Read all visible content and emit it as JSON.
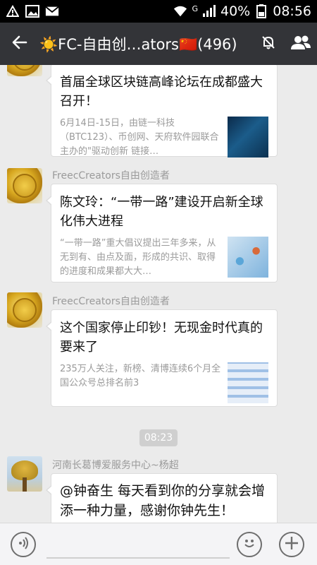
{
  "status_bar": {
    "network_label": "G",
    "battery": "40%",
    "time": "08:56"
  },
  "title_bar": {
    "title": "☀️FC-自由创…ators🇨🇳(496)",
    "icons": [
      "back-arrow-icon",
      "mute-bell-icon",
      "group-members-icon"
    ]
  },
  "messages": [
    {
      "type": "article",
      "title": "首届全球区块链高峰论坛在成都盛大召开！",
      "description": "6月14日-15日，由链一科技（BTC123）、币创网、天府软件园联合主办的\"驱动创新 链接…"
    },
    {
      "type": "article",
      "sender": "FreecCreators自由创造者",
      "title": "陈文玲：“一带一路”建设开启新全球化伟大进程",
      "description": "“一带一路”重大倡议提出三年多来，从无到有、由点及面，形成的共识、取得的进度和成果都大大…"
    },
    {
      "type": "article",
      "sender": "FreecCreators自由创造者",
      "title": "这个国家停止印钞！无现金时代真的要来了",
      "description": "235万人关注，新榜、清博连续6个月全国公众号总排名前3"
    }
  ],
  "timestamp": "08:23",
  "last_message": {
    "sender": "河南长葛博爱服务中心~杨超",
    "text": "@钟奋生 每天看到你的分享就会增添一种力量，感谢你钟先生！"
  },
  "input_bar": {
    "text_value": ""
  }
}
